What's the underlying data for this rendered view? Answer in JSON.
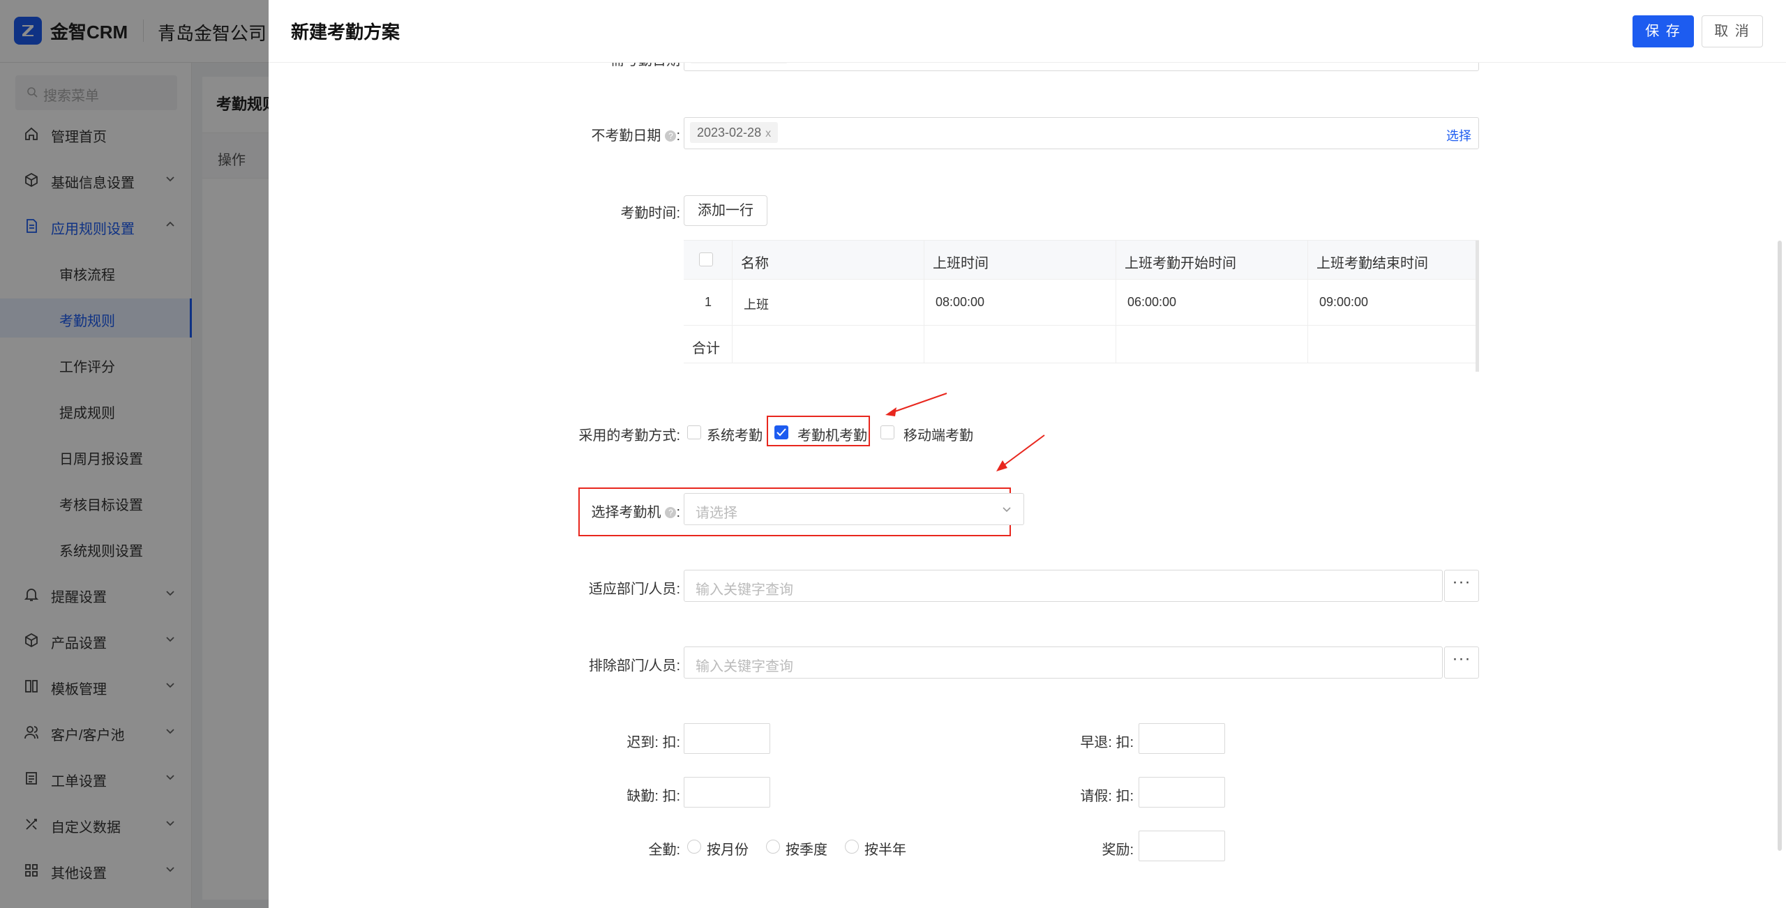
{
  "app": {
    "brand": "金智CRM",
    "company": "青岛金智公司",
    "search_placeholder": "搜索菜单",
    "sidebar": [
      {
        "label": "管理首页",
        "icon": "home-icon"
      },
      {
        "label": "基础信息设置",
        "icon": "cube-icon"
      },
      {
        "label": "应用规则设置",
        "icon": "document-icon"
      },
      {
        "label": "审核流程"
      },
      {
        "label": "考勤规则"
      },
      {
        "label": "工作评分"
      },
      {
        "label": "提成规则"
      },
      {
        "label": "日周月报设置"
      },
      {
        "label": "考核目标设置"
      },
      {
        "label": "系统规则设置"
      },
      {
        "label": "提醒设置",
        "icon": "bell-icon"
      },
      {
        "label": "产品设置",
        "icon": "cube-icon"
      },
      {
        "label": "模板管理",
        "icon": "template-icon"
      },
      {
        "label": "客户/客户池",
        "icon": "users-icon"
      },
      {
        "label": "工单设置",
        "icon": "ticket-icon"
      },
      {
        "label": "自定义数据",
        "icon": "tools-icon"
      },
      {
        "label": "其他设置",
        "icon": "grid-icon"
      }
    ],
    "content_title": "考勤规则",
    "content_col": "操作"
  },
  "drawer": {
    "title": "新建考勤方案",
    "save_label": "保 存",
    "cancel_label": "取 消",
    "top_partial_label": "需考勤日期",
    "no_attendance_label": "不考勤日期",
    "no_attendance_tag": "2023-02-28",
    "tag_close": "x",
    "pick_link": "选择",
    "attendance_time_label": "考勤时间",
    "add_row_label": "添加一行",
    "table": {
      "headers": [
        "名称",
        "上班时间",
        "上班考勤开始时间",
        "上班考勤结束时间"
      ],
      "row": {
        "index": "1",
        "name": "上班",
        "work_time": "08:00:00",
        "start_time": "06:00:00",
        "end_time": "09:00:00"
      },
      "footer": "合计"
    },
    "method_label": "采用的考勤方式",
    "methods": [
      {
        "label": "系统考勤",
        "checked": false
      },
      {
        "label": "考勤机考勤",
        "checked": true
      },
      {
        "label": "移动端考勤",
        "checked": false
      }
    ],
    "machine_label": "选择考勤机",
    "machine_placeholder": "请选择",
    "dept_label": "适应部门/人员",
    "dept_placeholder": "输入关键字查询",
    "exclude_label": "排除部门/人员",
    "exclude_placeholder": "输入关键字查询",
    "dots": "···",
    "late_label": "迟到",
    "early_label": "早退",
    "absent_label": "缺勤",
    "leave_label": "请假",
    "deduct": "扣",
    "full_label": "全勤",
    "full_options": [
      "按月份",
      "按季度",
      "按半年"
    ],
    "reward_label": "奖励"
  },
  "colors": {
    "accent": "#1d5cf0",
    "annotation": "#e8271e"
  }
}
